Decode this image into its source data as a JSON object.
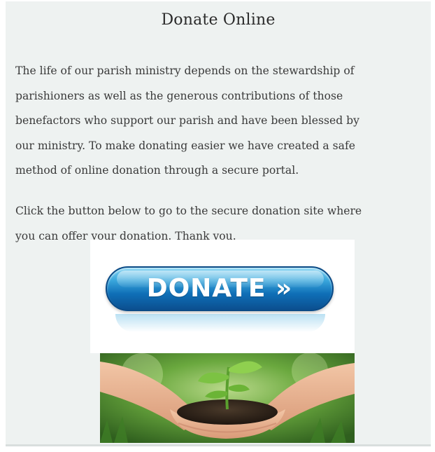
{
  "title": "Donate Online",
  "paragraph1": [
    "The life of our parish ministry depends on the stewardship of",
    "parishioners as well as the generous contributions of those",
    "benefactors who support our parish and have been blessed by",
    "our ministry.  To make donating easier we have created a safe",
    "method of online donation through a secure portal."
  ],
  "paragraph2": [
    "Click the button below to go to the secure donation site where",
    "you can offer your donation.  Thank you."
  ],
  "donate_button": {
    "label": "DONATE »"
  },
  "plant_image": {
    "icon": "hands-holding-seedling-icon"
  },
  "colors": {
    "panel_bg": "#eef2f1",
    "text": "#3a3a3a",
    "button_blue": "#0f6fb7"
  }
}
